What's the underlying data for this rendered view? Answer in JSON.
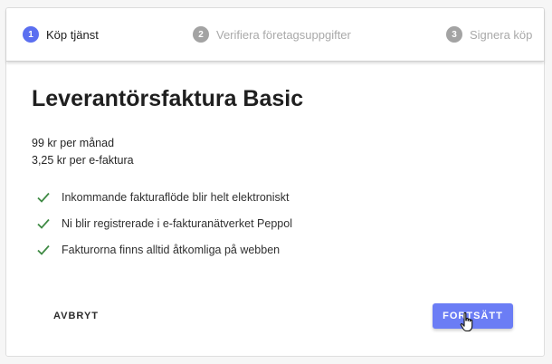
{
  "stepper": {
    "steps": [
      {
        "number": "1",
        "label": "Köp tjänst",
        "state": "active"
      },
      {
        "number": "2",
        "label": "Verifiera företagsuppgifter",
        "state": "inactive"
      },
      {
        "number": "3",
        "label": "Signera köp",
        "state": "inactive"
      }
    ]
  },
  "product": {
    "title": "Leverantörsfaktura Basic",
    "price_monthly": "99 kr per månad",
    "price_per_invoice": "3,25 kr per e-faktura",
    "features": [
      "Inkommande fakturaflöde blir helt elektroniskt",
      "Ni blir registrerade i e-fakturanätverket Peppol",
      "Fakturorna finns alltid åtkomliga på webben"
    ]
  },
  "actions": {
    "cancel_label": "AVBRYT",
    "continue_label": "FORTSÄTT"
  },
  "colors": {
    "accent": "#5b6ff0",
    "button": "#6b7df5",
    "check": "#3f8a44",
    "inactive": "#a3a3a3"
  },
  "icons": {
    "feature": "check-icon",
    "pointer": "hand-pointer-icon"
  }
}
